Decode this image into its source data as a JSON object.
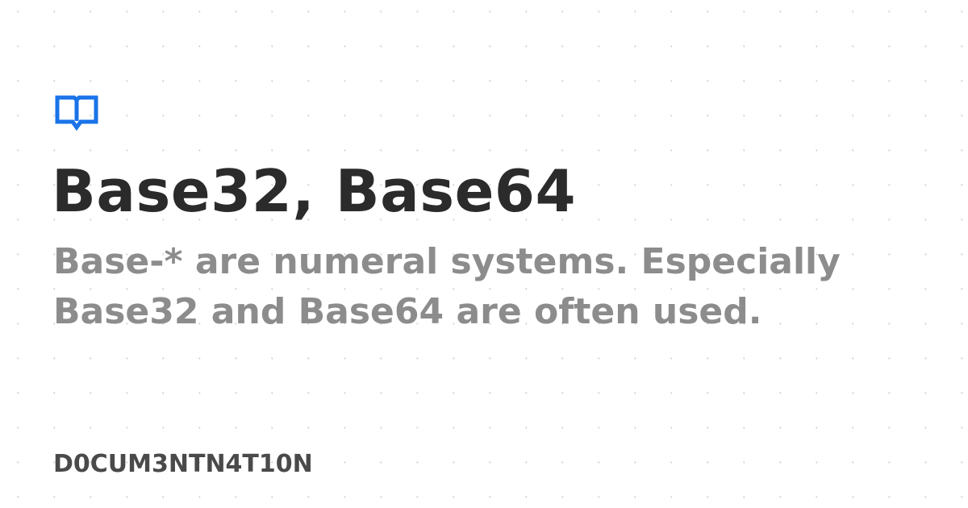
{
  "brand": {
    "icon": "book-icon",
    "accent_color": "#1a73e8"
  },
  "header": {
    "title": "Base32, Base64"
  },
  "main": {
    "description": "Base-* are numeral systems. Especially Base32 and Base64 are often used."
  },
  "footer": {
    "site_name": "D0CUM3NTN4T10N"
  },
  "colors": {
    "background": "#ffffff",
    "title": "#2b2b2b",
    "description": "#8c8c8c",
    "site_name": "#4a4a4a",
    "pattern_dots": "#d0d0d0"
  }
}
